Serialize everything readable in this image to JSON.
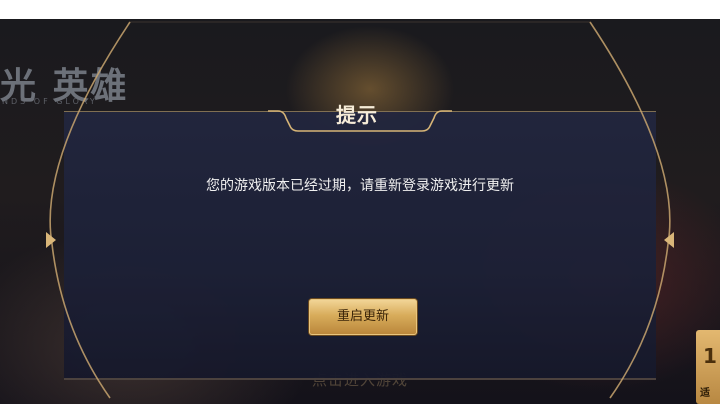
{
  "background": {
    "logo_text": "光 英雄",
    "logo_subtext": "NDS OF GLORY",
    "bottom_hint": "点击进入游戏"
  },
  "dialog": {
    "title": "提示",
    "message": "您的游戏版本已经过期，请重新登录游戏进行更新",
    "restart_button_label": "重启更新"
  },
  "side_badge": {
    "number": "1",
    "label": "适"
  },
  "colors": {
    "dialog_bg": "#22263e",
    "frame_gold": "#c8a56e",
    "button_gold": "#d8ac5b",
    "title_text": "#f6ecd8"
  }
}
